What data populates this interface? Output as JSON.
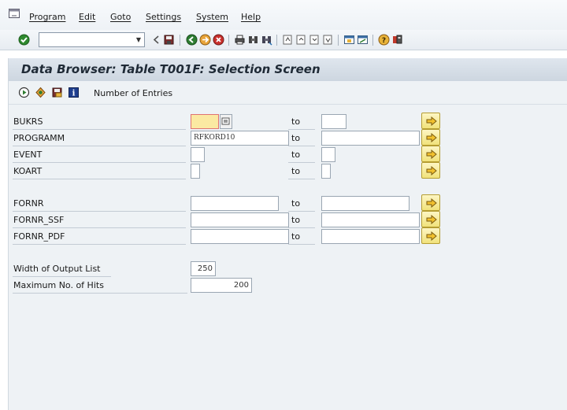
{
  "menu": {
    "items": [
      "Program",
      "Edit",
      "Goto",
      "Settings",
      "System",
      "Help"
    ]
  },
  "toolbar": {
    "command_field_value": ""
  },
  "screen": {
    "title": "Data Browser: Table T001F: Selection Screen"
  },
  "app_toolbar": {
    "number_of_entries_label": "Number of Entries"
  },
  "selection": {
    "to_label": "to",
    "rows": [
      {
        "label": "BUKRS",
        "low": "",
        "high": ""
      },
      {
        "label": "PROGRAMM",
        "low": "RFKORD10",
        "high": ""
      },
      {
        "label": "EVENT",
        "low": "",
        "high": ""
      },
      {
        "label": "KOART",
        "low": "",
        "high": ""
      },
      {
        "label": "FORNR",
        "low": "",
        "high": ""
      },
      {
        "label": "FORNR_SSF",
        "low": "",
        "high": ""
      },
      {
        "label": "FORNR_PDF",
        "low": "",
        "high": ""
      }
    ]
  },
  "output": {
    "width_label": "Width of Output List",
    "width_value": "250",
    "max_hits_label": "Maximum No. of Hits",
    "max_hits_value": "200"
  },
  "colors": {
    "focus_field": "#fbe9a2",
    "multiple_selection_button": "#f1e27b",
    "panel_background": "#eef2f5"
  }
}
